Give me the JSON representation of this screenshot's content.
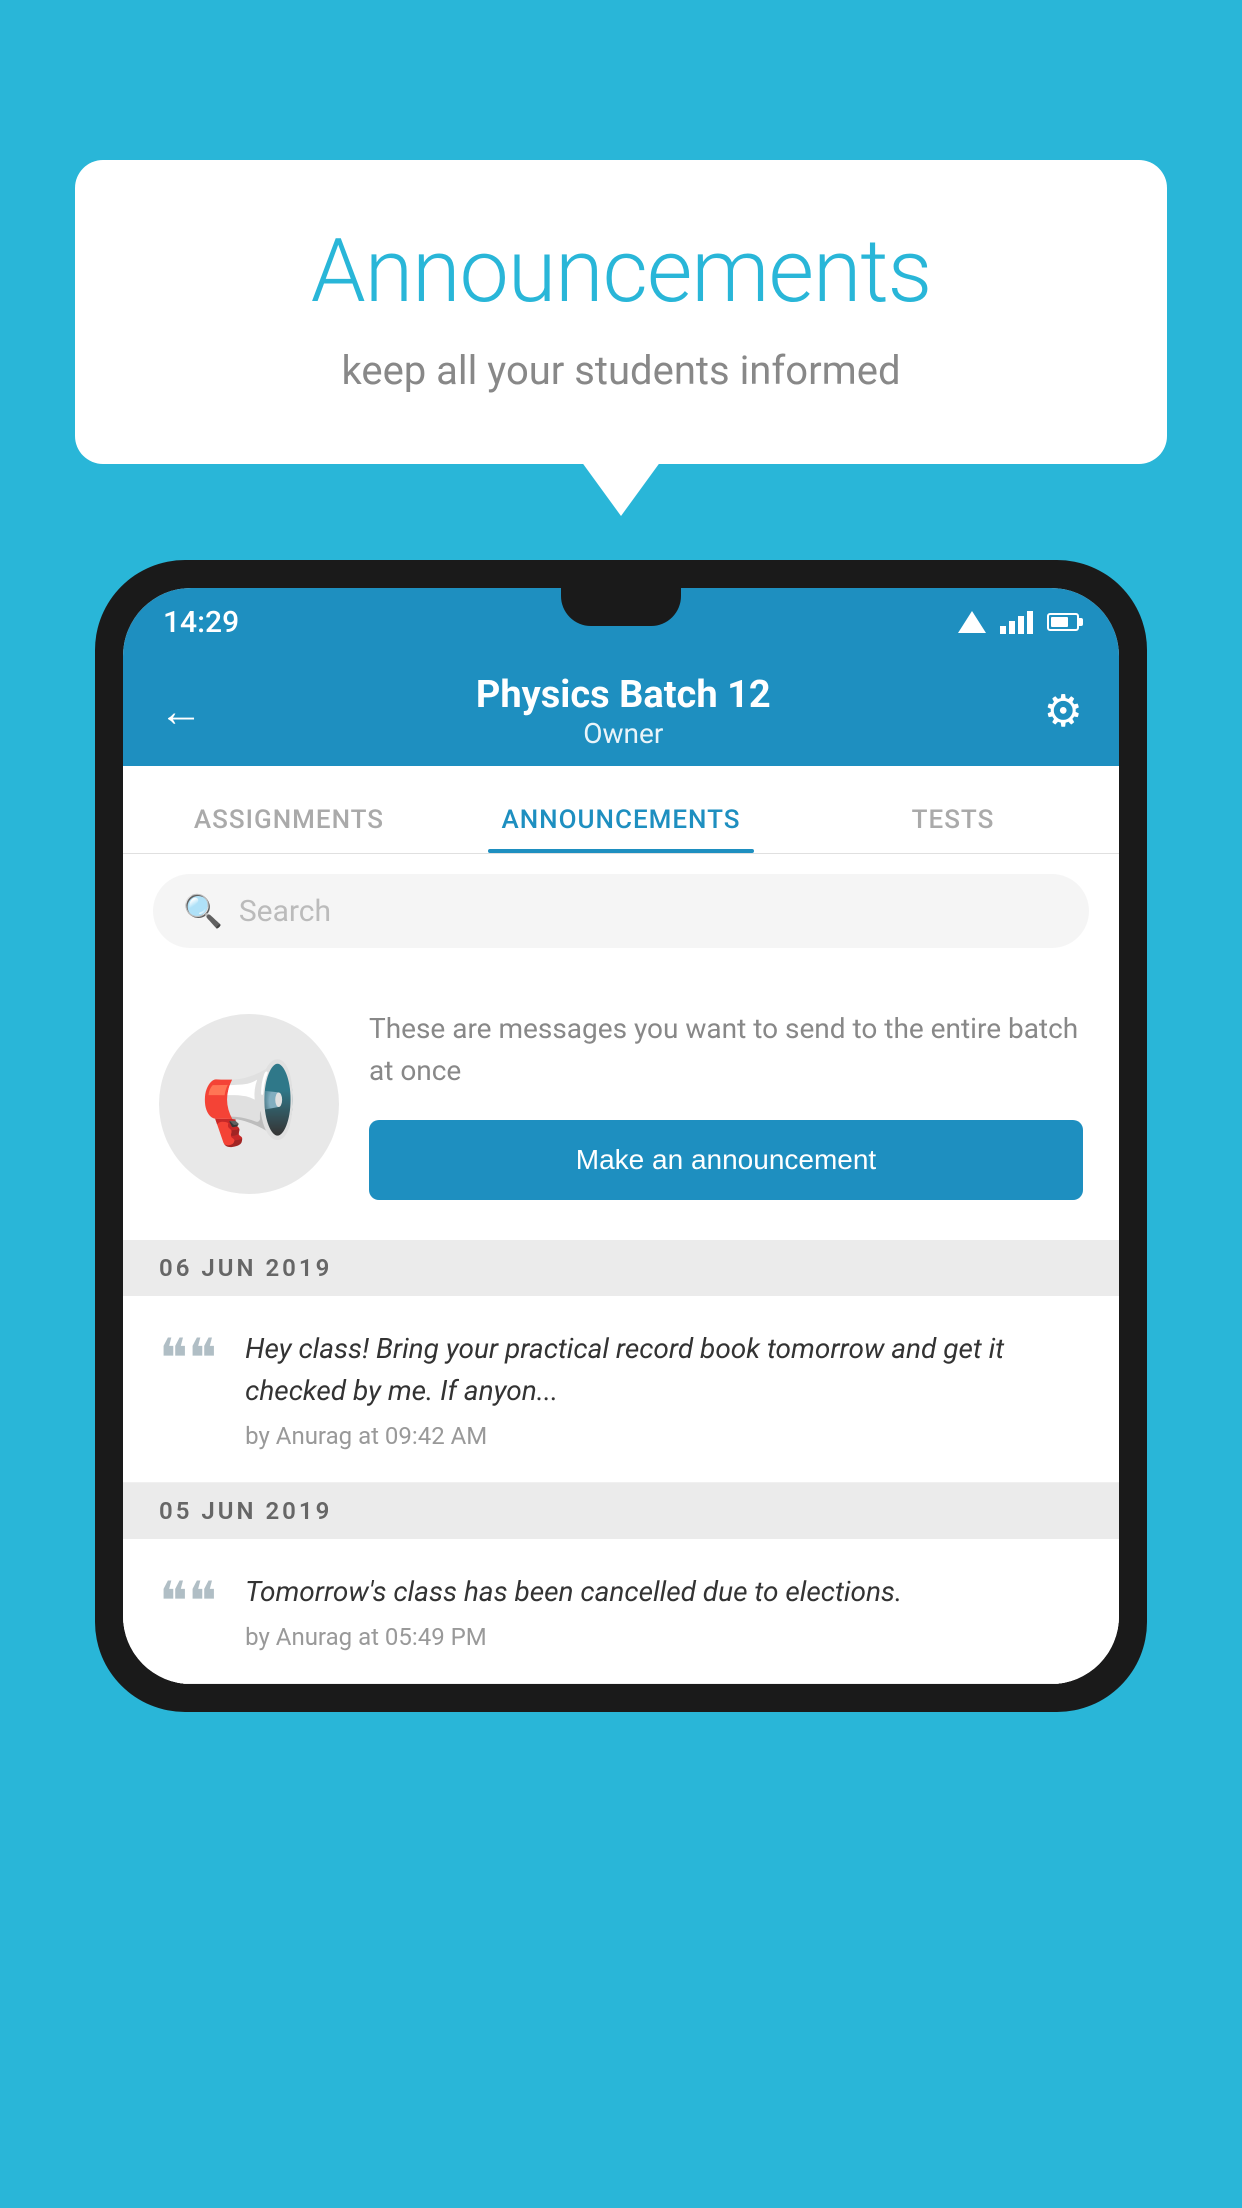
{
  "bubble": {
    "title": "Announcements",
    "subtitle": "keep all your students informed"
  },
  "statusBar": {
    "time": "14:29"
  },
  "appBar": {
    "title": "Physics Batch 12",
    "subtitle": "Owner"
  },
  "tabs": [
    {
      "label": "ASSIGNMENTS",
      "active": false
    },
    {
      "label": "ANNOUNCEMENTS",
      "active": true
    },
    {
      "label": "TESTS",
      "active": false
    }
  ],
  "search": {
    "placeholder": "Search"
  },
  "promo": {
    "description": "These are messages you want to send to the entire batch at once",
    "buttonLabel": "Make an announcement"
  },
  "dateDividers": [
    {
      "label": "06  JUN  2019"
    },
    {
      "label": "05  JUN  2019"
    }
  ],
  "announcements": [
    {
      "text": "Hey class! Bring your practical record book tomorrow and get it checked by me. If anyon...",
      "meta": "by Anurag at 09:42 AM"
    },
    {
      "text": "Tomorrow's class has been cancelled due to elections.",
      "meta": "by Anurag at 05:49 PM"
    }
  ]
}
